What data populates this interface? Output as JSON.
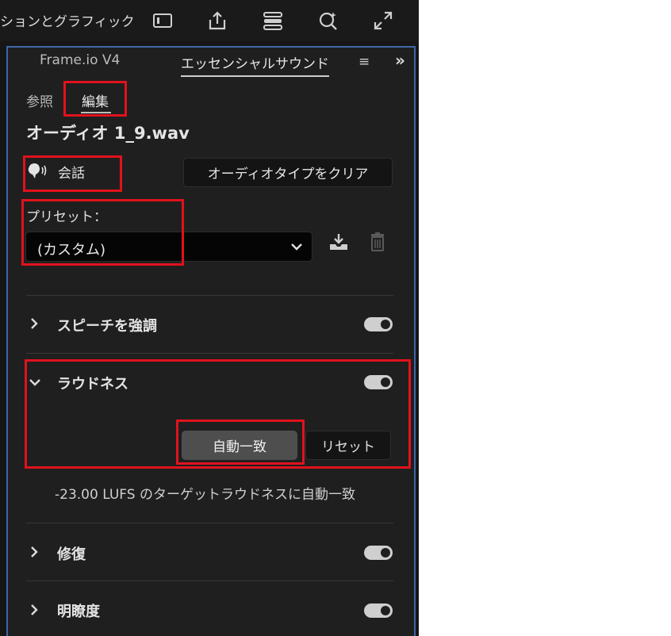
{
  "topbar": {
    "workspace_label": "ションとグラフィック",
    "icons": [
      "panel-layout-icon",
      "export-share-icon",
      "workspace-list-icon",
      "quick-search-icon",
      "fullscreen-icon"
    ]
  },
  "panel": {
    "tabs": [
      {
        "label": "Frame.io V4"
      },
      {
        "label": "エッセンシャルサウンド"
      }
    ],
    "menu_glyph": "≡",
    "overflow_glyph": "»"
  },
  "subtabs": {
    "browse": "参照",
    "edit": "編集"
  },
  "clip": {
    "filename": "オーディオ 1_9.wav",
    "audio_type": "会話",
    "clear_button": "オーディオタイプをクリア"
  },
  "preset": {
    "label": "プリセット：",
    "value": "(カスタム)"
  },
  "sections": [
    {
      "title": "スピーチを強調",
      "expanded": false,
      "enabled": true
    },
    {
      "title": "ラウドネス",
      "expanded": true,
      "enabled": true
    },
    {
      "title": "修復",
      "expanded": false,
      "enabled": true
    },
    {
      "title": "明瞭度",
      "expanded": false,
      "enabled": true
    }
  ],
  "loudness": {
    "auto_match_button": "自動一致",
    "reset_button": "リセット",
    "note": "-23.00 LUFS のターゲットラウドネスに自動一致"
  },
  "colors": {
    "highlight": "#e0121c",
    "panel_border": "#3e67a8",
    "panel_bg": "#1f1f1f"
  }
}
